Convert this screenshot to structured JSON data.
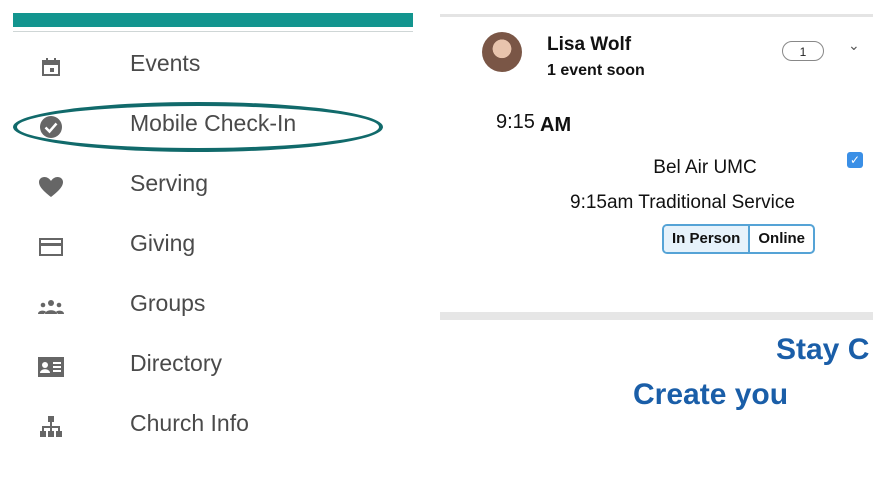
{
  "menu": {
    "items": [
      {
        "label": "Events",
        "icon": "calendar-icon"
      },
      {
        "label": "Mobile Check-In",
        "icon": "check-circle-icon"
      },
      {
        "label": "Serving",
        "icon": "heart-icon"
      },
      {
        "label": "Giving",
        "icon": "credit-card-icon"
      },
      {
        "label": "Groups",
        "icon": "people-icon"
      },
      {
        "label": "Directory",
        "icon": "contact-card-icon"
      },
      {
        "label": "Church Info",
        "icon": "org-chart-icon"
      }
    ],
    "accent_color": "#13958f",
    "highlight_color": "#116a6b"
  },
  "card": {
    "user_name": "Lisa Wolf",
    "user_sub": "1 event soon",
    "event_count": "1",
    "time": "9:15",
    "time_ampm": "AM",
    "location": "Bel Air UMC",
    "service": "9:15am Traditional Service",
    "mode_options": [
      "In Person",
      "Online"
    ],
    "selected_mode": "In Person"
  },
  "headline": {
    "line1": "Stay C",
    "line2": "Create you",
    "color": "#1a5ea8"
  }
}
